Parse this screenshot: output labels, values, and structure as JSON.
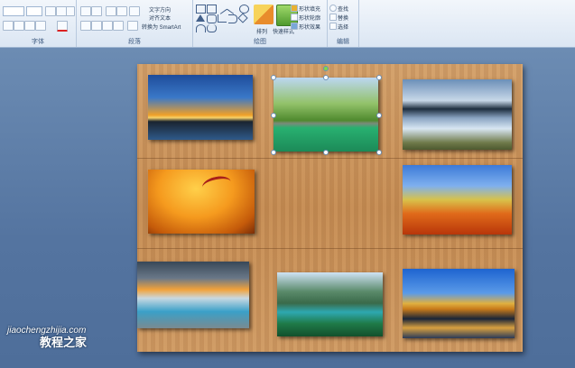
{
  "ribbon": {
    "groups": {
      "font": "字体",
      "paragraph": "段落",
      "drawing": "绘图",
      "editing": "编辑"
    },
    "paragraph": {
      "text_direction": "文字方向",
      "align_text": "对齐文本",
      "convert_smartart": "转换为 SmartArt"
    },
    "drawing": {
      "arrange": "排列",
      "quick_styles": "快速样式",
      "shape_fill": "形状填充",
      "shape_outline": "形状轮廓",
      "shape_effects": "形状效果"
    },
    "editing": {
      "find": "查找",
      "replace": "替换",
      "select": "选择"
    }
  },
  "watermark": {
    "site": "jiaochengzhijia.com",
    "name": "教程之家"
  },
  "colors": {
    "ribbon_bg": "#dbe6f3",
    "workspace": "#5f7fa6",
    "wood": "#c98f55"
  }
}
